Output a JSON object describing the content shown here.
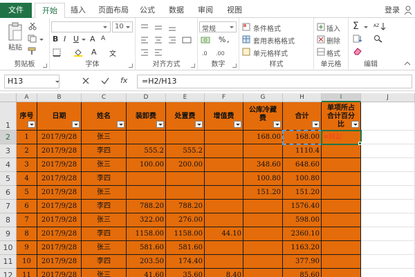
{
  "tabs": [
    {
      "label": "文件",
      "active": false
    },
    {
      "label": "开始",
      "active": true
    },
    {
      "label": "插入",
      "active": false
    },
    {
      "label": "页面布局",
      "active": false
    },
    {
      "label": "公式",
      "active": false
    },
    {
      "label": "数据",
      "active": false
    },
    {
      "label": "审阅",
      "active": false
    },
    {
      "label": "视图",
      "active": false
    }
  ],
  "login_label": "登录",
  "ribbon": {
    "clipboard": {
      "label": "剪贴板",
      "paste": "粘贴"
    },
    "font": {
      "label": "字体",
      "size": "10"
    },
    "alignment": {
      "label": "对齐方式"
    },
    "number": {
      "label": "数字",
      "format": "常规",
      "percent": "%"
    },
    "styles": {
      "label": "样式",
      "conditional": "条件格式",
      "table": "套用表格格式",
      "cell": "单元格样式"
    },
    "cells": {
      "label": "单元格",
      "insert": "插入",
      "delete": "删除",
      "format": "格式"
    },
    "editing": {
      "label": "编辑"
    }
  },
  "formula_bar": {
    "name_box": "H13",
    "formula": "=H2/H13",
    "fx": "fx"
  },
  "columns": [
    "A",
    "B",
    "C",
    "D",
    "E",
    "F",
    "G",
    "H",
    "I",
    "J"
  ],
  "selected_column": "I",
  "headers": [
    "序号",
    "日期",
    "姓名",
    "装卸费",
    "处置费",
    "增值费",
    "公库冷藏费",
    "合计",
    "单项所占合计百分比"
  ],
  "header_lines": {
    "G": [
      "公库冷藏",
      "费"
    ],
    "I": [
      "单项所占",
      "合计百分",
      "比"
    ]
  },
  "row_numbers": [
    "1",
    "2",
    "3",
    "4",
    "5",
    "6",
    "7",
    "8",
    "9",
    "10",
    "11",
    "12"
  ],
  "selected_row": "2",
  "rows": [
    [
      "1",
      "2017/9/28",
      "张三",
      "",
      "",
      "",
      "168.00",
      "168.00",
      "=H2/"
    ],
    [
      "2",
      "2017/9/28",
      "李四",
      "555.2",
      "555.2",
      "",
      "",
      "1110.4",
      ""
    ],
    [
      "3",
      "2017/9/28",
      "张三",
      "100.00",
      "200.00",
      "",
      "348.60",
      "648.60",
      ""
    ],
    [
      "4",
      "2017/9/28",
      "李四",
      "",
      "",
      "",
      "100.80",
      "100.80",
      ""
    ],
    [
      "5",
      "2017/9/28",
      "张三",
      "",
      "",
      "",
      "151.20",
      "151.20",
      ""
    ],
    [
      "6",
      "2017/9/28",
      "李四",
      "788.20",
      "788.20",
      "",
      "",
      "1576.40",
      ""
    ],
    [
      "7",
      "2017/9/28",
      "张三",
      "322.00",
      "276.00",
      "",
      "",
      "598.00",
      ""
    ],
    [
      "8",
      "2017/9/28",
      "李四",
      "1158.00",
      "1158.00",
      "44.10",
      "",
      "2360.10",
      ""
    ],
    [
      "9",
      "2017/9/28",
      "张三",
      "581.60",
      "581.60",
      "",
      "",
      "1163.20",
      ""
    ],
    [
      "10",
      "2017/9/28",
      "李四",
      "203.50",
      "174.40",
      "",
      "",
      "377.90",
      ""
    ],
    [
      "11",
      "2017/9/28",
      "张三",
      "41.60",
      "35.60",
      "8.40",
      "",
      "85.60",
      ""
    ]
  ],
  "colors": {
    "table_fill": "#e46c0a",
    "accent": "#217346",
    "formula_ref": "#ff3333"
  }
}
